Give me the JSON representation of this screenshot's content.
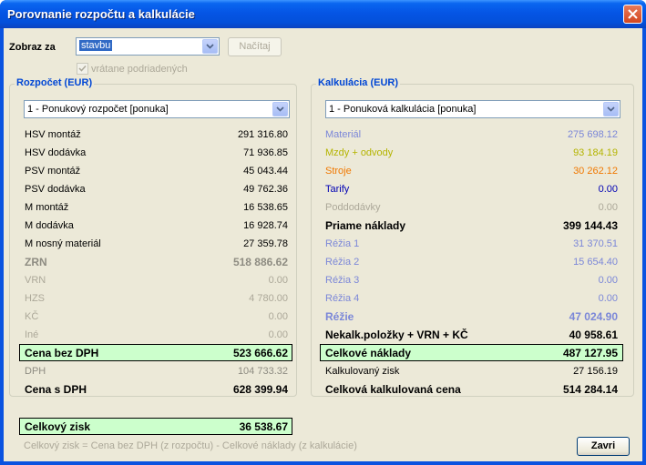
{
  "window": {
    "title": "Porovnanie rozpočtu a kalkulácie"
  },
  "top": {
    "show_label": "Zobraz za",
    "show_value": "stavbu",
    "load_button": "Načítaj",
    "include_sub_label": "vrátane podriadených",
    "include_sub_checked": true
  },
  "budget": {
    "title": "Rozpočet (EUR)",
    "select_value": "1 - Ponukový rozpočet [ponuka]",
    "rows": [
      {
        "label": "HSV montáž",
        "value": "291 316.80"
      },
      {
        "label": "HSV dodávka",
        "value": "71 936.85"
      },
      {
        "label": "PSV montáž",
        "value": "45 043.44"
      },
      {
        "label": "PSV dodávka",
        "value": "49 762.36"
      },
      {
        "label": "M montáž",
        "value": "16 538.65"
      },
      {
        "label": "M dodávka",
        "value": "16 928.74"
      },
      {
        "label": "M nosný materiál",
        "value": "27 359.78"
      },
      {
        "label": "ZRN",
        "value": "518 886.62"
      },
      {
        "label": "VRN",
        "value": "0.00"
      },
      {
        "label": "HZS",
        "value": "4 780.00"
      },
      {
        "label": "KČ",
        "value": "0.00"
      },
      {
        "label": "Iné",
        "value": "0.00"
      }
    ],
    "price_no_vat_label": "Cena bez DPH",
    "price_no_vat_value": "523 666.62",
    "vat_label": "DPH",
    "vat_value": "104 733.32",
    "price_vat_label": "Cena s DPH",
    "price_vat_value": "628 399.94"
  },
  "calc": {
    "title": "Kalkulácia (EUR)",
    "select_value": "1 - Ponuková kalkulácia [ponuka]",
    "rows": [
      {
        "label": "Materiál",
        "value": "275 698.12"
      },
      {
        "label": "Mzdy + odvody",
        "value": "93 184.19"
      },
      {
        "label": "Stroje",
        "value": "30 262.12"
      },
      {
        "label": "Tarify",
        "value": "0.00"
      },
      {
        "label": "Poddodávky",
        "value": "0.00"
      },
      {
        "label": "Priame náklady",
        "value": "399 144.43"
      },
      {
        "label": "Réžia 1",
        "value": "31 370.51"
      },
      {
        "label": "Réžia 2",
        "value": "15 654.40"
      },
      {
        "label": "Réžia 3",
        "value": "0.00"
      },
      {
        "label": "Réžia 4",
        "value": "0.00"
      },
      {
        "label": "Réžie",
        "value": "47 024.90"
      },
      {
        "label": "Nekalk.položky + VRN + KČ",
        "value": "40 958.61"
      }
    ],
    "total_cost_label": "Celkové náklady",
    "total_cost_value": "487 127.95",
    "profit_label": "Kalkulovaný zisk",
    "profit_value": "27 156.19",
    "total_price_label": "Celková kalkulovaná cena",
    "total_price_value": "514 284.14"
  },
  "summary": {
    "label": "Celkový zisk",
    "value": "36 538.67",
    "note": "Celkový zisk = Cena bez DPH (z rozpočtu) - Celkové náklady (z kalkulácie)"
  },
  "close_button": "Zavri",
  "colors": {
    "titlebar": "#0555e5",
    "group_title": "#0046d5",
    "highlight": "#ccffcc",
    "material": "#7b87d8",
    "wages": "#b4b400",
    "machines": "#f07800",
    "tariffs": "#0000b4"
  }
}
